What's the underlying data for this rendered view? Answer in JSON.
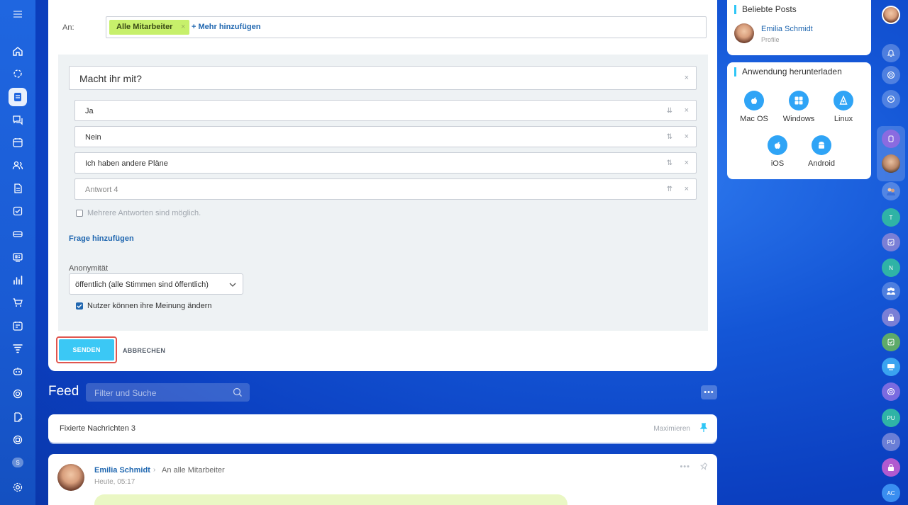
{
  "composer": {
    "to_label": "An:",
    "recipient_chip": "Alle Mitarbeiter",
    "chip_remove": "×",
    "add_more": "+ Mehr hinzufügen"
  },
  "poll": {
    "question": "Macht ihr mit?",
    "answers": [
      {
        "text": "Ja",
        "sort_icon": "⇊"
      },
      {
        "text": "Nein",
        "sort_icon": "⇅"
      },
      {
        "text": "Ich haben andere Pläne",
        "sort_icon": "⇅"
      }
    ],
    "answer_placeholder": "Antwort  4",
    "placeholder_sort_icon": "⇈",
    "remove_symbol": "×",
    "multiple_answers": "Mehrere Antworten sind möglich.",
    "add_question": "Frage hinzufügen",
    "anonymity_label": "Anonymität",
    "anonymity_value": "öffentlich (alle Stimmen sind öffentlich)",
    "change_opinion": "Nutzer können ihre Meinung ändern"
  },
  "actions": {
    "send": "SENDEN",
    "cancel": "ABBRECHEN"
  },
  "feed": {
    "title": "Feed",
    "search_placeholder": "Filter und Suche",
    "more": "•••",
    "pinned_title": "Fixierte Nachrichten 3",
    "pinned_maximize": "Maximieren",
    "post": {
      "author": "Emilia Schmidt",
      "arrow": "›",
      "target": "An alle Mitarbeiter",
      "time": "Heute, 05:17",
      "more": "•••"
    }
  },
  "widgets": {
    "popular_posts": {
      "title": "Beliebte Posts",
      "name": "Emilia Schmidt",
      "subtitle": "Profile"
    },
    "download_app": {
      "title": "Anwendung herunterladen",
      "apps": [
        "Mac OS",
        "Windows",
        "Linux",
        "iOS",
        "Android"
      ]
    }
  },
  "right_rail": {
    "initials": [
      "T",
      "N",
      "PU",
      "PU",
      "AC"
    ]
  },
  "left_nav": {
    "badge": "S"
  },
  "colors": {
    "accent_blue": "#2067b0",
    "send_button": "#3bc8f5",
    "chip_green": "#c7f06b",
    "highlight_red": "#e0564f",
    "panel_accent": "#2fc6f6"
  }
}
